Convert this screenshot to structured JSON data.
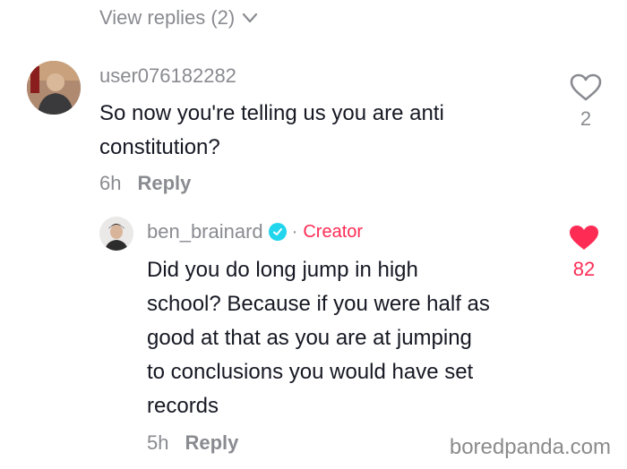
{
  "view_replies": {
    "label": "View replies (2)"
  },
  "comments": [
    {
      "username": "user076182282",
      "text_lines": [
        "So now you're telling us you are anti",
        "constitution?"
      ],
      "time": "6h",
      "reply_label": "Reply",
      "likes": "2",
      "liked": false
    },
    {
      "username": "ben_brainard",
      "badge": "Creator",
      "separator": "·",
      "text_lines": [
        "Did you do long jump in high",
        "school? Because if you were half as",
        "good at that as you are at jumping",
        "to conclusions you would have set",
        "records"
      ],
      "time": "5h",
      "reply_label": "Reply",
      "likes": "82",
      "liked": true
    }
  ],
  "watermark": "boredpanda.com",
  "colors": {
    "accent_red": "#fe2c55",
    "muted_gray": "#8a8b91",
    "verified_blue": "#20d5ec"
  }
}
